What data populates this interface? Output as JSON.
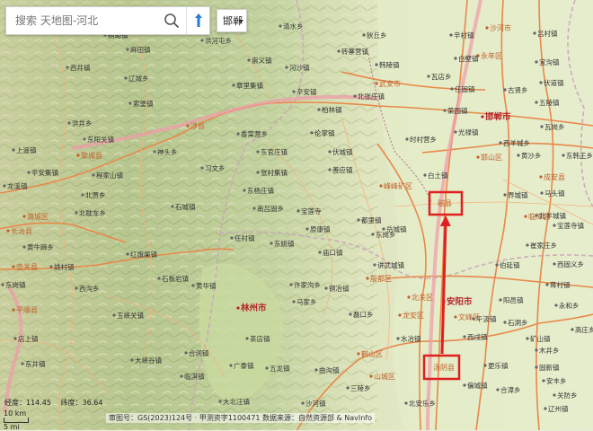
{
  "search": {
    "placeholder": "搜索 天地图-河北"
  },
  "region_selector": {
    "label": "邯郸"
  },
  "coordinates": {
    "lon_label": "经度：114.45",
    "lat_label": "纬度：36.64"
  },
  "scale": {
    "label_km": "10 km",
    "label_mi": "5 mi"
  },
  "attribution": "审图号：GS(2023)124号 · 甲测资字1100471 数据来源：自然资源部 & NavInfo",
  "highlights": [
    {
      "name": "磁县"
    },
    {
      "name": "汤阴县"
    }
  ],
  "colors": {
    "highlight": "#e02020",
    "road": "#e8884a",
    "city": "#b3262b",
    "county": "#c0612b"
  },
  "map_labels": {
    "cities": [
      "邯郸市",
      "安阳市",
      "林州市"
    ],
    "counties": [
      "沙河市",
      "永年区",
      "武安市",
      "峰峰矿区",
      "邯山区",
      "成安县",
      "临漳县",
      "涉县",
      "北关区",
      "龙安区",
      "殷都区",
      "文峰区",
      "鹤山区",
      "山城区",
      "汤阴县",
      "磁县",
      "平顺县",
      "潞城区",
      "黎城县",
      "壶关县",
      "长治县"
    ],
    "towns": [
      "清水乡",
      "石坂镇",
      "桐峪镇",
      "麻田镇",
      "西井镇",
      "辽城乡",
      "索堡镇",
      "神头乡",
      "东阳关镇",
      "洪井乡",
      "上遥镇",
      "辛安集镇",
      "龙溪镇",
      "程家山镇",
      "北耽车乡",
      "黄牛蹄乡",
      "石城镇",
      "北贾乡",
      "红旗渠镇",
      "姚村镇",
      "石板岩镇",
      "西沟乡",
      "东岗镇",
      "黄华镇",
      "玉峡关镇",
      "店上镇",
      "东井镇",
      "大峡谷镇",
      "任村镇",
      "东姚镇",
      "茶店镇",
      "合涧镇",
      "临淇镇",
      "原康镇",
      "五龙镇",
      "马家乡",
      "庙口镇",
      "铜冶镇",
      "许家沟乡",
      "磊口乡",
      "水冶镇",
      "曲沟镇",
      "善应镇",
      "都里镇",
      "东岗乡",
      "伦掌镇",
      "伏城镇",
      "岳城镇",
      "讲武城镇",
      "时村营乡",
      "白土镇",
      "光禄镇",
      "西羊城乡",
      "黄沙乡",
      "界城镇",
      "马头镇",
      "北羊城镇",
      "宝莲寺镇",
      "崔家庄乡",
      "西固义乡",
      "伯延镇",
      "阳邑镇",
      "午汲镇",
      "石洞乡",
      "矿山镇",
      "木井乡",
      "西戌镇",
      "更乐镇",
      "固新镇",
      "关防乡",
      "合漳乡",
      "偏城镇",
      "辽州镇",
      "北安乐乡",
      "三陵乡",
      "沙河镇",
      "大北汪镇",
      "广泰镇",
      "东杨庄镇",
      "南吕固乡",
      "辛安镇",
      "柏林镇",
      "北张庄镇",
      "砖寨营镇",
      "狄丘乡",
      "河沙镇",
      "章里集镇",
      "香菜营乡",
      "习文乡",
      "张村集镇",
      "东官庄镇",
      "宝莲寺",
      "洪河屯乡",
      "崇义镇",
      "韩陵镇",
      "菜园镇",
      "任固镇",
      "瓦店乡",
      "辛村镇",
      "白壁镇",
      "吕村镇",
      "宜沟镇",
      "伏道镇",
      "古贤乡",
      "五陵镇",
      "瓦岗乡",
      "东韩王乡",
      "蒋村镇",
      "永和乡",
      "高庄乡",
      "安丰乡"
    ]
  }
}
